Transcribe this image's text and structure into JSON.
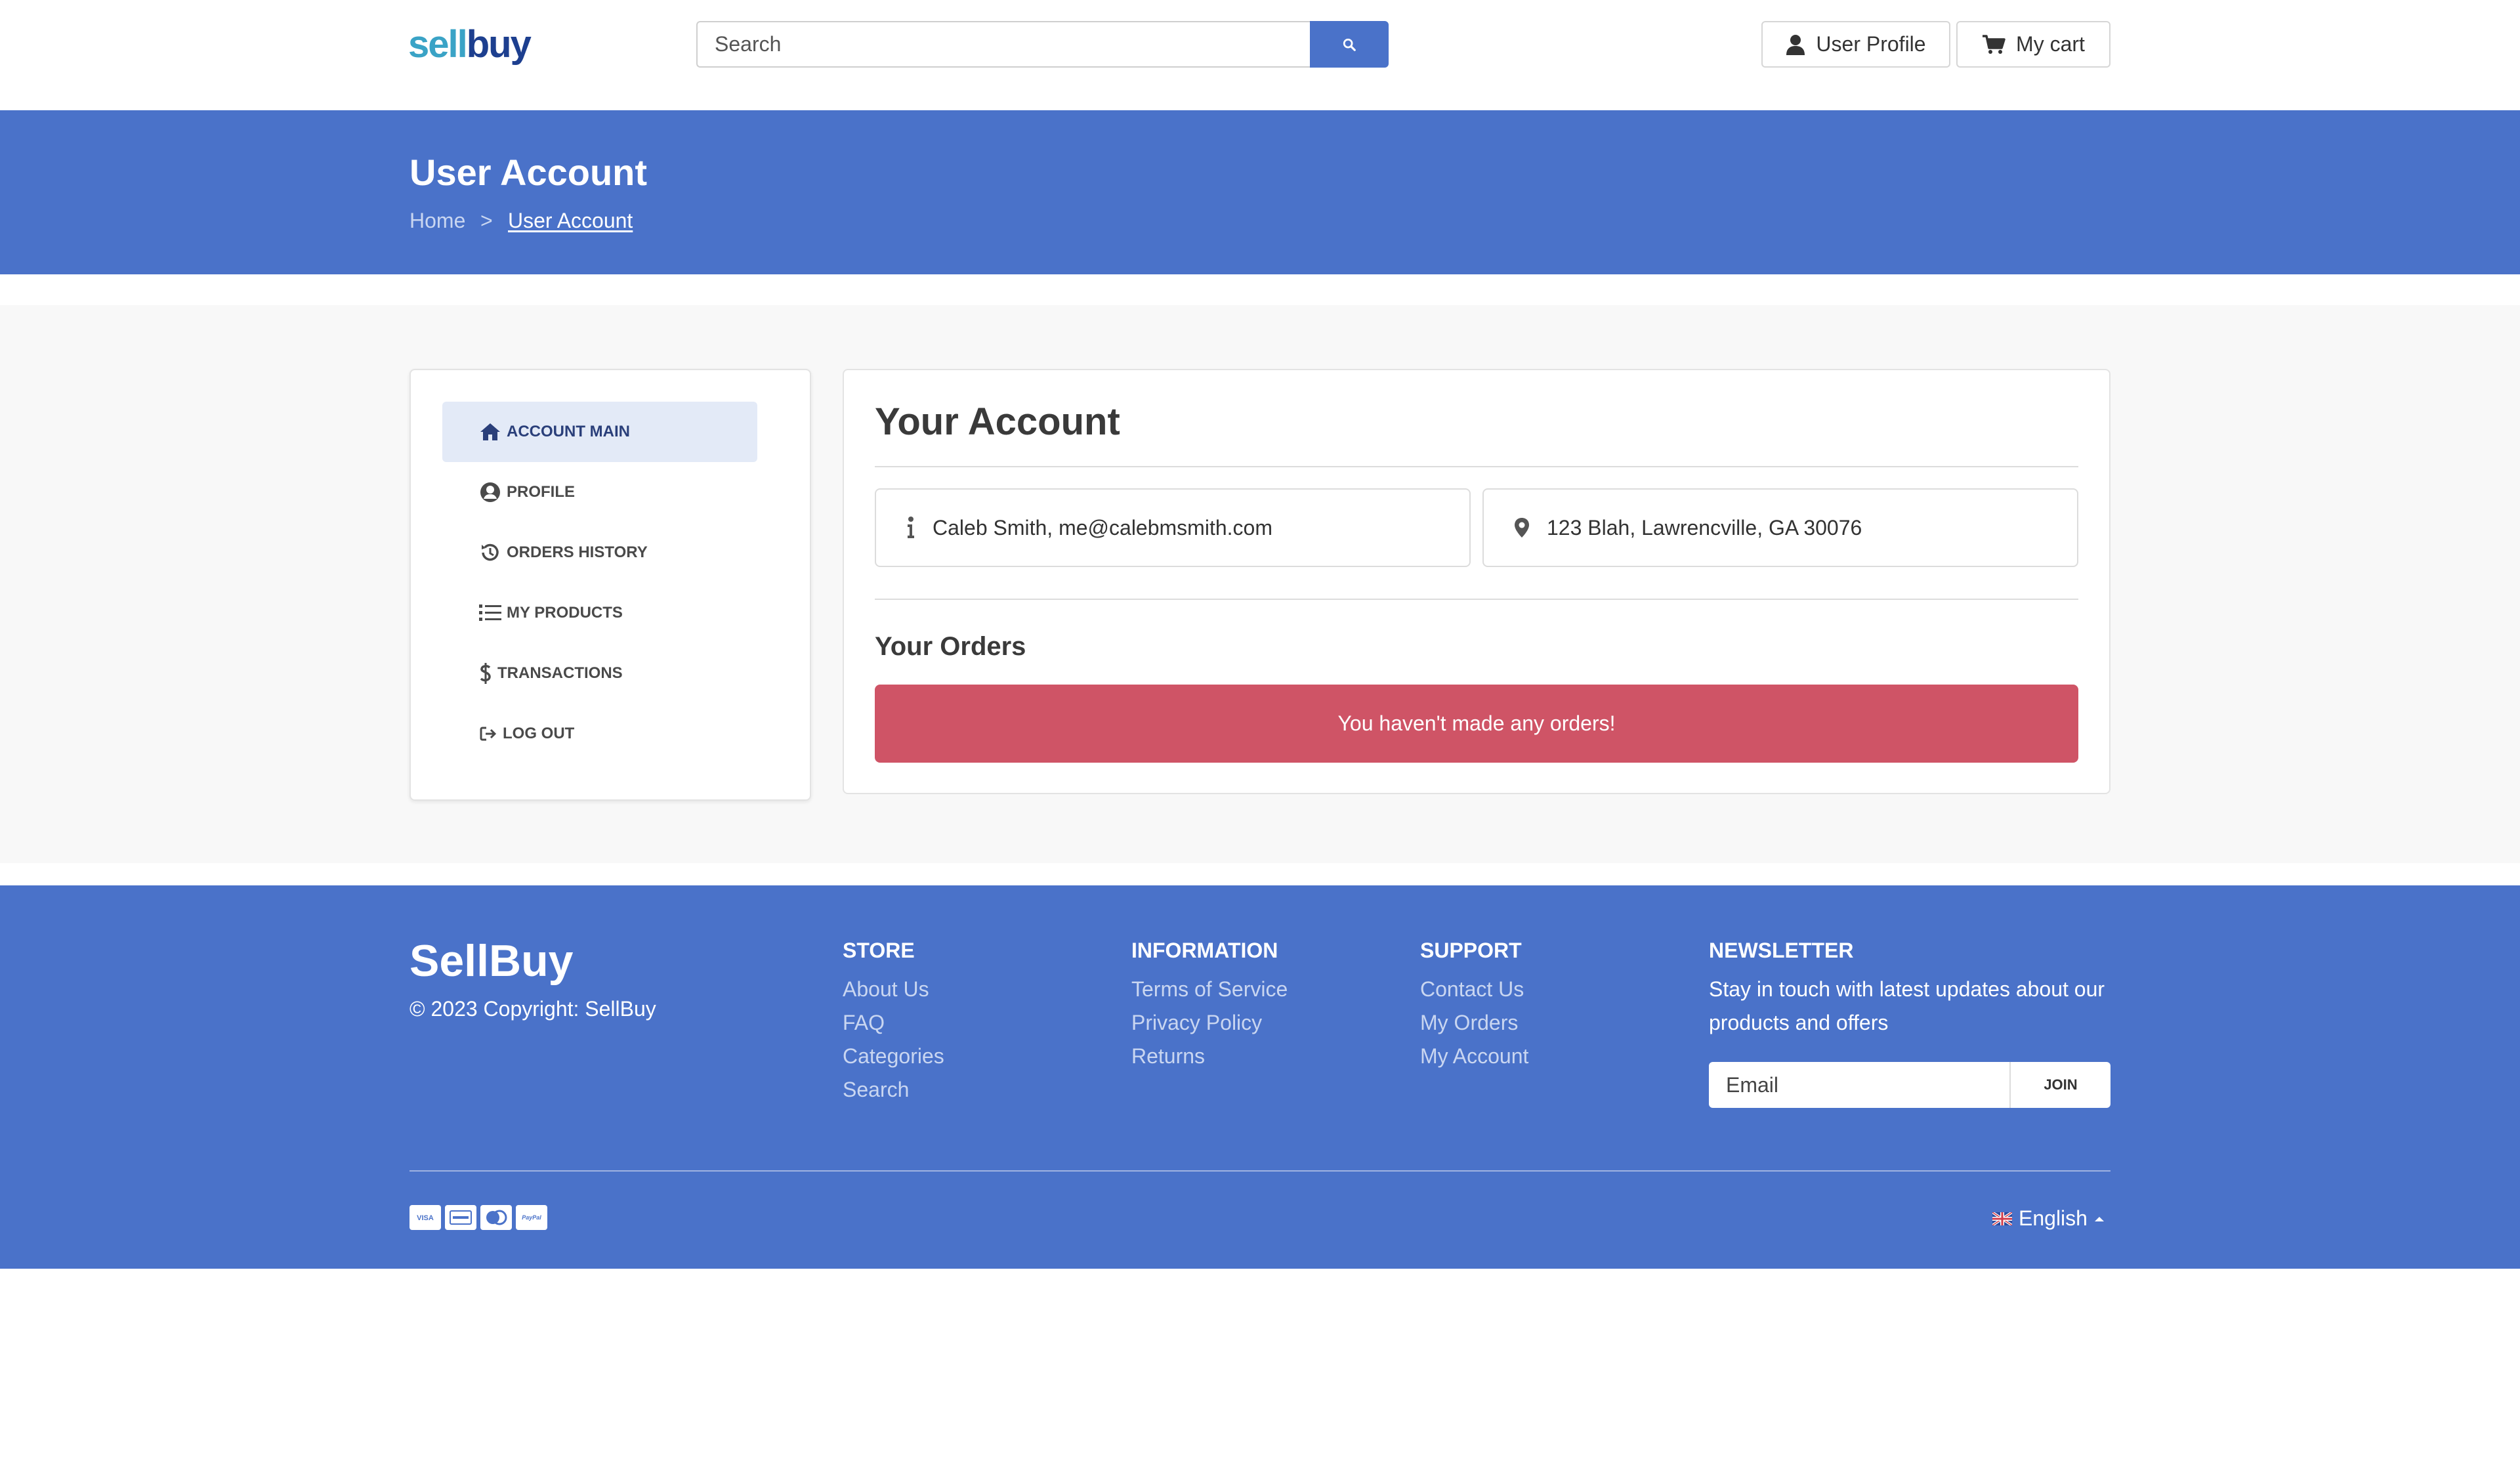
{
  "header": {
    "logo_part1": "sell",
    "logo_part2": "buy",
    "search_placeholder": "Search",
    "user_profile_label": "User Profile",
    "cart_label": "My cart"
  },
  "banner": {
    "title": "User Account",
    "breadcrumb": {
      "home": "Home",
      "separator": ">",
      "current": "User Account"
    }
  },
  "sidebar": {
    "items": [
      {
        "label": "Account Main",
        "icon": "home-icon",
        "active": true
      },
      {
        "label": "Profile",
        "icon": "user-circle-icon",
        "active": false
      },
      {
        "label": "Orders History",
        "icon": "history-icon",
        "active": false
      },
      {
        "label": "My Products",
        "icon": "list-icon",
        "active": false
      },
      {
        "label": "Transactions",
        "icon": "dollar-icon",
        "active": false
      },
      {
        "label": "Log Out",
        "icon": "logout-icon",
        "active": false
      }
    ]
  },
  "account": {
    "title": "Your Account",
    "user_info": "Caleb Smith, me@calebmsmith.com",
    "address": "123 Blah, Lawrencville, GA 30076",
    "orders_title": "Your Orders",
    "orders_empty": "You haven't made any orders!"
  },
  "footer": {
    "brand": "SellBuy",
    "copyright": "© 2023 Copyright: SellBuy",
    "columns": [
      {
        "title": "Store",
        "links": [
          "About Us",
          "FAQ",
          "Categories",
          "Search"
        ]
      },
      {
        "title": "Information",
        "links": [
          "Terms of Service",
          "Privacy Policy",
          "Returns"
        ]
      },
      {
        "title": "Support",
        "links": [
          "Contact Us",
          "My Orders",
          "My Account"
        ]
      }
    ],
    "newsletter": {
      "title": "Newsletter",
      "text": "Stay in touch with latest updates about our products and offers",
      "email_placeholder": "Email",
      "join_label": "Join"
    },
    "payment_icons": [
      "visa-icon",
      "amex-icon",
      "mastercard-icon",
      "paypal-icon"
    ],
    "language": "English"
  },
  "colors": {
    "brand_blue": "#4a72c9",
    "logo_light": "#3aa3c6",
    "logo_dark": "#1d3f8f",
    "alert_red": "#cf5466",
    "active_nav_bg": "#e3eaf7"
  }
}
